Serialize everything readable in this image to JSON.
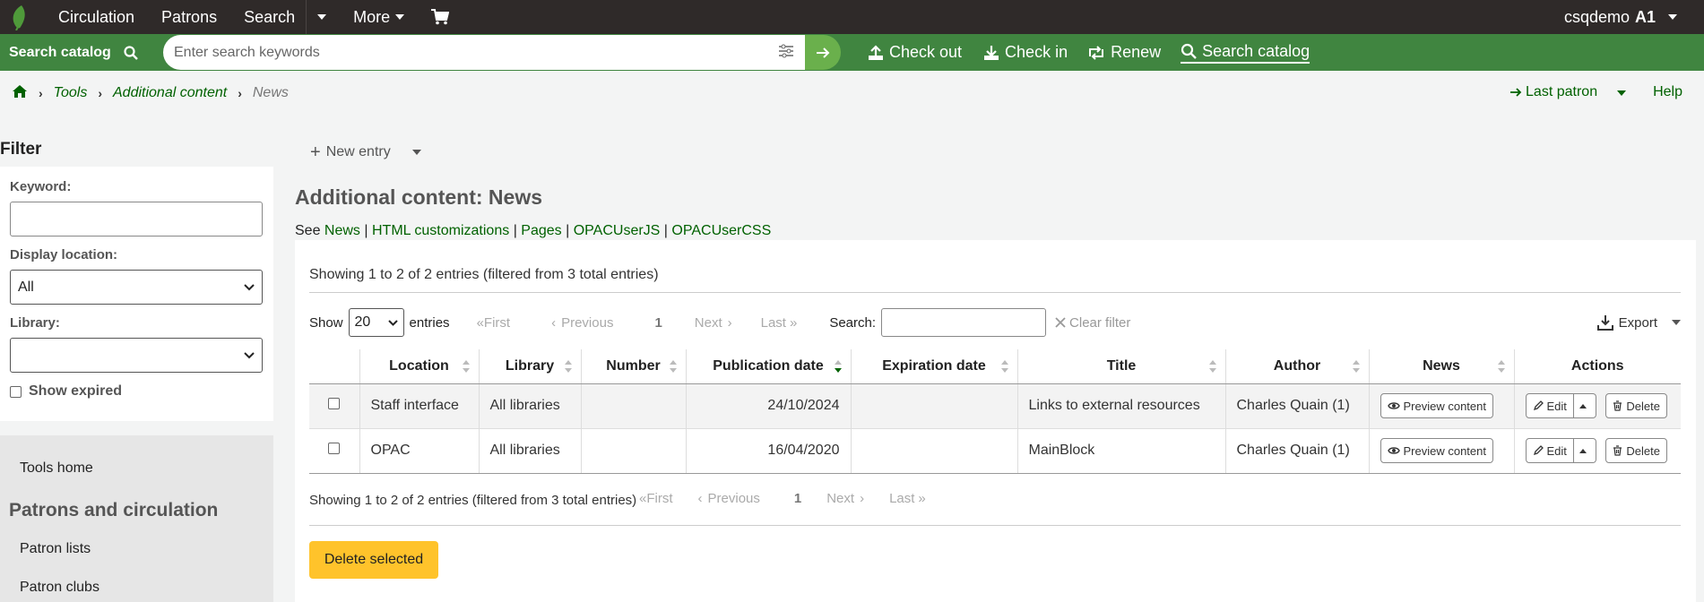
{
  "colors": {
    "topbar": "#2f2a29",
    "searchbar": "#408540",
    "link": "#006100",
    "delete_button": "#ffc32b"
  },
  "topnav": {
    "items": [
      "Circulation",
      "Patrons",
      "Search",
      "More"
    ],
    "user": "csqdemo",
    "branch": "A1"
  },
  "searchbar": {
    "label": "Search catalog",
    "placeholder": "Enter search keywords",
    "actions": [
      "Check out",
      "Check in",
      "Renew",
      "Search catalog"
    ]
  },
  "breadcrumb": {
    "items": [
      "Tools",
      "Additional content"
    ],
    "current": "News"
  },
  "toplinks": {
    "last_patron": "Last patron",
    "help": "Help"
  },
  "sidebar": {
    "filter_title": "Filter",
    "keyword_label": "Keyword:",
    "keyword_value": "",
    "display_location_label": "Display location:",
    "display_location_value": "All",
    "library_label": "Library:",
    "library_value": "",
    "show_expired_label": "Show expired",
    "nav": {
      "tools_home": "Tools home",
      "section": "Patrons and circulation",
      "items": [
        "Patron lists",
        "Patron clubs"
      ]
    }
  },
  "main": {
    "new_entry": "New entry",
    "title": "Additional content: News",
    "see_prefix": "See",
    "see_links": [
      "News",
      "HTML customizations",
      "Pages",
      "OPACUserJS",
      "OPACUserCSS"
    ],
    "see_sep": "|",
    "info_top": "Showing 1 to 2 of 2 entries (filtered from 3 total entries)",
    "info_bottom": "Showing 1 to 2 of 2 entries (filtered from 3 total entries)",
    "show_label": "Show",
    "page_length": "20",
    "entries_label": "entries",
    "pager": {
      "first": "First",
      "previous": "Previous",
      "current": "1",
      "next": "Next",
      "last": "Last"
    },
    "search_label": "Search:",
    "clear_filter": "Clear filter",
    "export": "Export",
    "columns": [
      "Location",
      "Library",
      "Number",
      "Publication date",
      "Expiration date",
      "Title",
      "Author",
      "News",
      "Actions"
    ],
    "rows": [
      {
        "location": "Staff interface",
        "library": "All libraries",
        "number": "",
        "publication_date": "24/10/2024",
        "expiration_date": "",
        "title": "Links to external resources",
        "author": "Charles Quain (1)"
      },
      {
        "location": "OPAC",
        "library": "All libraries",
        "number": "",
        "publication_date": "16/04/2020",
        "expiration_date": "",
        "title": "MainBlock",
        "author": "Charles Quain (1)"
      }
    ],
    "preview_label": "Preview content",
    "edit_label": "Edit",
    "delete_label": "Delete",
    "delete_selected": "Delete selected"
  }
}
